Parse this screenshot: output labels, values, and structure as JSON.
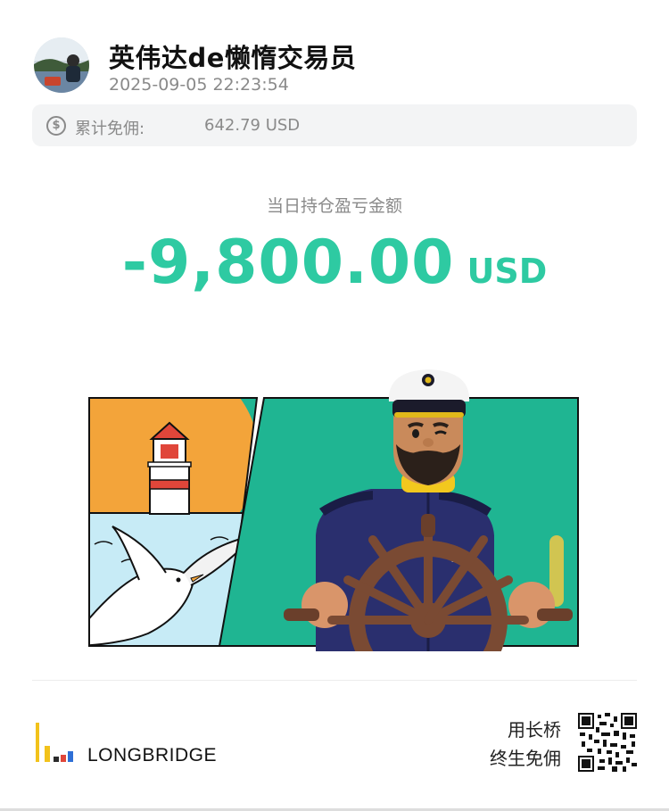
{
  "header": {
    "username": "英伟达de懒惰交易员",
    "timestamp": "2025-09-05 22:23:54"
  },
  "rebate": {
    "icon": "dollar-circle-icon",
    "label": "累计免佣:",
    "value": "642.79 USD"
  },
  "pnl": {
    "label": "当日持仓盈亏金额",
    "amount": "-9,800.00",
    "currency": "USD",
    "color": "#2ecaa2"
  },
  "footer": {
    "brand_name": "LONGBRIDGE",
    "promo_line1": "用长桥",
    "promo_line2": "终生免佣"
  },
  "colors": {
    "accent_green": "#2ecaa2",
    "illustration_teal": "#1fb592",
    "sun_orange": "#f3a43a",
    "sea_blue": "#c7ebf6",
    "uniform_navy": "#2a2f6e"
  }
}
